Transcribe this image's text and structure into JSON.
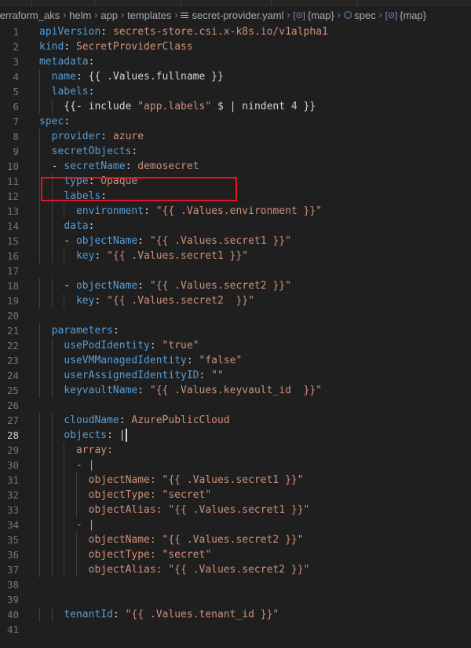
{
  "breadcrumb": [
    {
      "label": "terraform_aks",
      "icon": null
    },
    {
      "label": "helm",
      "icon": null
    },
    {
      "label": "app",
      "icon": null
    },
    {
      "label": "templates",
      "icon": null
    },
    {
      "label": "secret-provider.yaml",
      "icon": "file-lines-icon"
    },
    {
      "label": "{map}",
      "icon": "symbol-object-icon"
    },
    {
      "label": "spec",
      "icon": "symbol-cube-icon"
    },
    {
      "label": "{map}",
      "icon": "symbol-object-icon"
    }
  ],
  "separator": "›",
  "active_line": 28,
  "colors": {
    "key": "#569cd6",
    "value": "#ce9178",
    "punct": "#d4d4d4",
    "number": "#b5cea8",
    "highlight_border": "#e81123"
  },
  "lines": [
    [
      {
        "t": "apiVersion",
        "c": "k"
      },
      {
        "t": ": ",
        "c": "p"
      },
      {
        "t": "secrets-store.csi.x-k8s.io/v1alpha1",
        "c": "v"
      }
    ],
    [
      {
        "t": "kind",
        "c": "k"
      },
      {
        "t": ": ",
        "c": "p"
      },
      {
        "t": "SecretProviderClass",
        "c": "v"
      }
    ],
    [
      {
        "t": "metadata",
        "c": "k"
      },
      {
        "t": ":",
        "c": "p"
      }
    ],
    [
      {
        "t": "  ",
        "c": "p"
      },
      {
        "t": "name",
        "c": "k"
      },
      {
        "t": ": {{ .Values.fullname }}",
        "c": "p"
      }
    ],
    [
      {
        "t": "  ",
        "c": "p"
      },
      {
        "t": "labels",
        "c": "k"
      },
      {
        "t": ":",
        "c": "p"
      }
    ],
    [
      {
        "t": "    {{- include ",
        "c": "p"
      },
      {
        "t": "\"app.labels\"",
        "c": "v"
      },
      {
        "t": " $ | nindent ",
        "c": "p"
      },
      {
        "t": "4",
        "c": "n"
      },
      {
        "t": " }}",
        "c": "p"
      }
    ],
    [
      {
        "t": "spec",
        "c": "k"
      },
      {
        "t": ":",
        "c": "p"
      }
    ],
    [
      {
        "t": "  ",
        "c": "p"
      },
      {
        "t": "provider",
        "c": "k"
      },
      {
        "t": ": ",
        "c": "p"
      },
      {
        "t": "azure",
        "c": "v"
      }
    ],
    [
      {
        "t": "  ",
        "c": "p"
      },
      {
        "t": "secretObjects",
        "c": "k"
      },
      {
        "t": ":",
        "c": "p"
      }
    ],
    [
      {
        "t": "  - ",
        "c": "p"
      },
      {
        "t": "secretName",
        "c": "k"
      },
      {
        "t": ": ",
        "c": "p"
      },
      {
        "t": "demosecret",
        "c": "v"
      }
    ],
    [
      {
        "t": "    ",
        "c": "p"
      },
      {
        "t": "type",
        "c": "k"
      },
      {
        "t": ": ",
        "c": "p"
      },
      {
        "t": "Opaque",
        "c": "v"
      }
    ],
    [
      {
        "t": "    ",
        "c": "p"
      },
      {
        "t": "labels",
        "c": "k"
      },
      {
        "t": ":",
        "c": "p"
      }
    ],
    [
      {
        "t": "      ",
        "c": "p"
      },
      {
        "t": "environment",
        "c": "k"
      },
      {
        "t": ": ",
        "c": "p"
      },
      {
        "t": "\"{{ .Values.environment }}\"",
        "c": "v"
      }
    ],
    [
      {
        "t": "    ",
        "c": "p"
      },
      {
        "t": "data",
        "c": "k"
      },
      {
        "t": ":",
        "c": "p"
      }
    ],
    [
      {
        "t": "    - ",
        "c": "p"
      },
      {
        "t": "objectName",
        "c": "k"
      },
      {
        "t": ": ",
        "c": "p"
      },
      {
        "t": "\"{{ .Values.secret1 }}\"",
        "c": "v"
      }
    ],
    [
      {
        "t": "      ",
        "c": "p"
      },
      {
        "t": "key",
        "c": "k"
      },
      {
        "t": ": ",
        "c": "p"
      },
      {
        "t": "\"{{ .Values.secret1 }}\"",
        "c": "v"
      }
    ],
    [],
    [
      {
        "t": "    - ",
        "c": "p"
      },
      {
        "t": "objectName",
        "c": "k"
      },
      {
        "t": ": ",
        "c": "p"
      },
      {
        "t": "\"{{ .Values.secret2 }}\"",
        "c": "v"
      }
    ],
    [
      {
        "t": "      ",
        "c": "p"
      },
      {
        "t": "key",
        "c": "k"
      },
      {
        "t": ": ",
        "c": "p"
      },
      {
        "t": "\"{{ .Values.secret2  }}\"",
        "c": "v"
      }
    ],
    [],
    [
      {
        "t": "  ",
        "c": "p"
      },
      {
        "t": "parameters",
        "c": "k"
      },
      {
        "t": ":",
        "c": "p"
      }
    ],
    [
      {
        "t": "    ",
        "c": "p"
      },
      {
        "t": "usePodIdentity",
        "c": "k"
      },
      {
        "t": ": ",
        "c": "p"
      },
      {
        "t": "\"true\"",
        "c": "v"
      }
    ],
    [
      {
        "t": "    ",
        "c": "p"
      },
      {
        "t": "useVMManagedIdentity",
        "c": "k"
      },
      {
        "t": ": ",
        "c": "p"
      },
      {
        "t": "\"false\"",
        "c": "v"
      }
    ],
    [
      {
        "t": "    ",
        "c": "p"
      },
      {
        "t": "userAssignedIdentityID",
        "c": "k"
      },
      {
        "t": ": ",
        "c": "p"
      },
      {
        "t": "\"\"",
        "c": "v"
      }
    ],
    [
      {
        "t": "    ",
        "c": "p"
      },
      {
        "t": "keyvaultName",
        "c": "k"
      },
      {
        "t": ": ",
        "c": "p"
      },
      {
        "t": "\"{{ .Values.keyvault_id  }}\"",
        "c": "v"
      }
    ],
    [],
    [
      {
        "t": "    ",
        "c": "p"
      },
      {
        "t": "cloudName",
        "c": "k"
      },
      {
        "t": ": ",
        "c": "p"
      },
      {
        "t": "AzurePublicCloud",
        "c": "v"
      }
    ],
    [
      {
        "t": "    ",
        "c": "p"
      },
      {
        "t": "objects",
        "c": "k"
      },
      {
        "t": ": |",
        "c": "p"
      }
    ],
    [
      {
        "t": "      array:",
        "c": "v"
      }
    ],
    [
      {
        "t": "      - |",
        "c": "v"
      }
    ],
    [
      {
        "t": "        objectName: \"{{ .Values.secret1 }}\"",
        "c": "v"
      }
    ],
    [
      {
        "t": "        objectType: \"secret\"",
        "c": "v"
      }
    ],
    [
      {
        "t": "        objectAlias: \"{{ .Values.secret1 }}\"",
        "c": "v"
      }
    ],
    [
      {
        "t": "      - |",
        "c": "v"
      }
    ],
    [
      {
        "t": "        objectName: \"{{ .Values.secret2 }}\"",
        "c": "v"
      }
    ],
    [
      {
        "t": "        objectType: \"secret\"",
        "c": "v"
      }
    ],
    [
      {
        "t": "        objectAlias: \"{{ .Values.secret2 }}\"",
        "c": "v"
      }
    ],
    [],
    [],
    [
      {
        "t": "    ",
        "c": "p"
      },
      {
        "t": "tenantId",
        "c": "k"
      },
      {
        "t": ": ",
        "c": "p"
      },
      {
        "t": "\"{{ .Values.tenant_id }}\"",
        "c": "v"
      }
    ],
    []
  ]
}
